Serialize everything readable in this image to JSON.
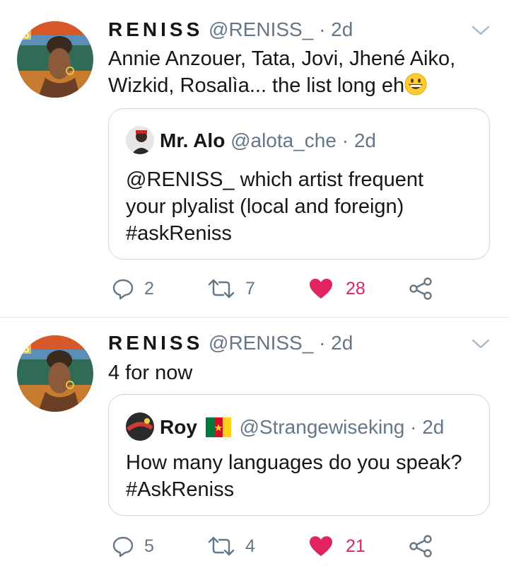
{
  "tweets": [
    {
      "name": "RENISS",
      "handle": "@RENISS_",
      "separator": "·",
      "time": "2d",
      "text": "Annie Anzouer, Tata, Jovi, Jhené Aiko, Wizkid, Rosalìa... the list long eh",
      "emoji": "grinning-face-emoji",
      "quoted": {
        "name": "Mr. Alo",
        "handle": "@alota_che",
        "separator": "·",
        "time": "2d",
        "text_line1": "@RENISS_  which artist frequent",
        "text_line2": "your plyalist (local and foreign)",
        "text_line3": "#askReniss"
      },
      "counts": {
        "replies": "2",
        "retweets": "7",
        "likes": "28"
      },
      "liked": true
    },
    {
      "name": "RENISS",
      "handle": "@RENISS_",
      "separator": "·",
      "time": "2d",
      "text": "4 for now",
      "quoted": {
        "name": "Roy",
        "flag": "cameroon-flag-icon",
        "handle": "@Strangewiseking",
        "separator": "·",
        "time": "2d",
        "text_line1": "How many languages do you speak?",
        "text_line2": "#AskReniss"
      },
      "counts": {
        "replies": "5",
        "retweets": "4",
        "likes": "21"
      },
      "liked": true
    }
  ],
  "colors": {
    "text": "#14171a",
    "muted": "#657786",
    "like": "#e0245e",
    "border": "#ccd6dd"
  }
}
